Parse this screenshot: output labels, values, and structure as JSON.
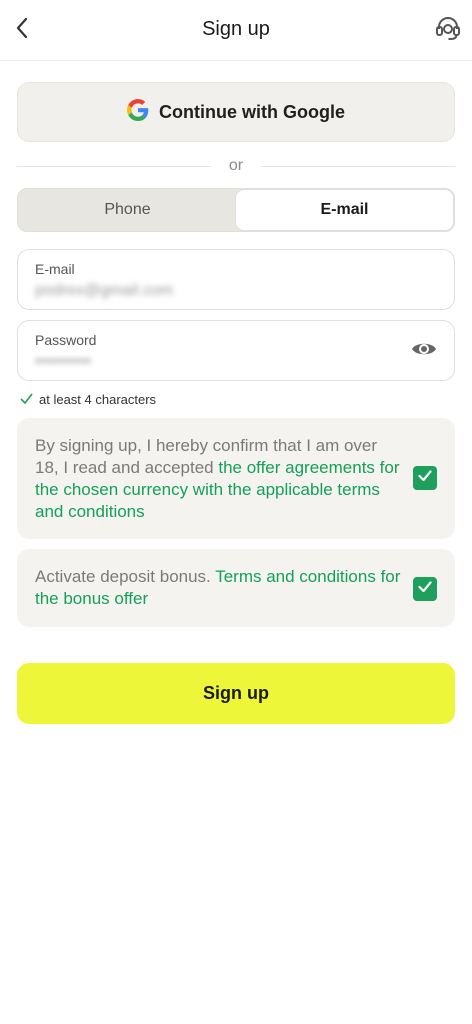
{
  "header": {
    "title": "Sign up",
    "back_icon": "chevron-left-icon",
    "support_icon": "headset-support-icon"
  },
  "google_button": {
    "label": "Continue with Google",
    "icon": "google-icon"
  },
  "divider": {
    "text": "or"
  },
  "tabs": [
    {
      "label": "Phone",
      "selected": false
    },
    {
      "label": "E-mail",
      "selected": true
    }
  ],
  "email_field": {
    "label": "E-mail",
    "value": "podrex@gmail.com"
  },
  "password_field": {
    "label": "Password",
    "value": "••••••••••",
    "toggle_icon": "eye-icon"
  },
  "password_hint": {
    "icon": "check-icon",
    "text": "at least 4 characters"
  },
  "consent_terms": {
    "text": "By signing up, I hereby confirm that I am over 18, I read and accepted ",
    "link": "the offer agreements for the chosen currency with the applicable terms and conditions",
    "checked": true
  },
  "consent_bonus": {
    "text": "Activate deposit bonus. ",
    "link": "Terms and conditions for the bonus offer",
    "checked": true
  },
  "signup_button": {
    "label": "Sign up"
  },
  "colors": {
    "accent_green": "#1ea05c",
    "cta_yellow": "#eef63a",
    "surface": "#f4f3ef"
  }
}
